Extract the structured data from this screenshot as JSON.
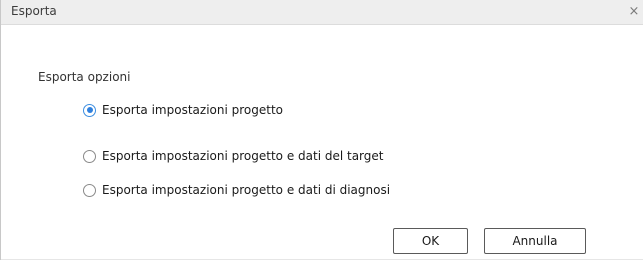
{
  "window": {
    "title": "Esporta",
    "close_glyph": "×"
  },
  "options": {
    "section_label": "Esporta opzioni",
    "items": [
      {
        "label": "Esporta impostazioni progetto",
        "selected": true
      },
      {
        "label": "Esporta impostazioni progetto e dati del target",
        "selected": false
      },
      {
        "label": "Esporta impostazioni progetto e dati di diagnosi",
        "selected": false
      }
    ]
  },
  "buttons": {
    "ok_label": "OK",
    "cancel_label": "Annulla"
  },
  "colors": {
    "accent": "#2f80de",
    "titlebar": "#eeeeee"
  }
}
